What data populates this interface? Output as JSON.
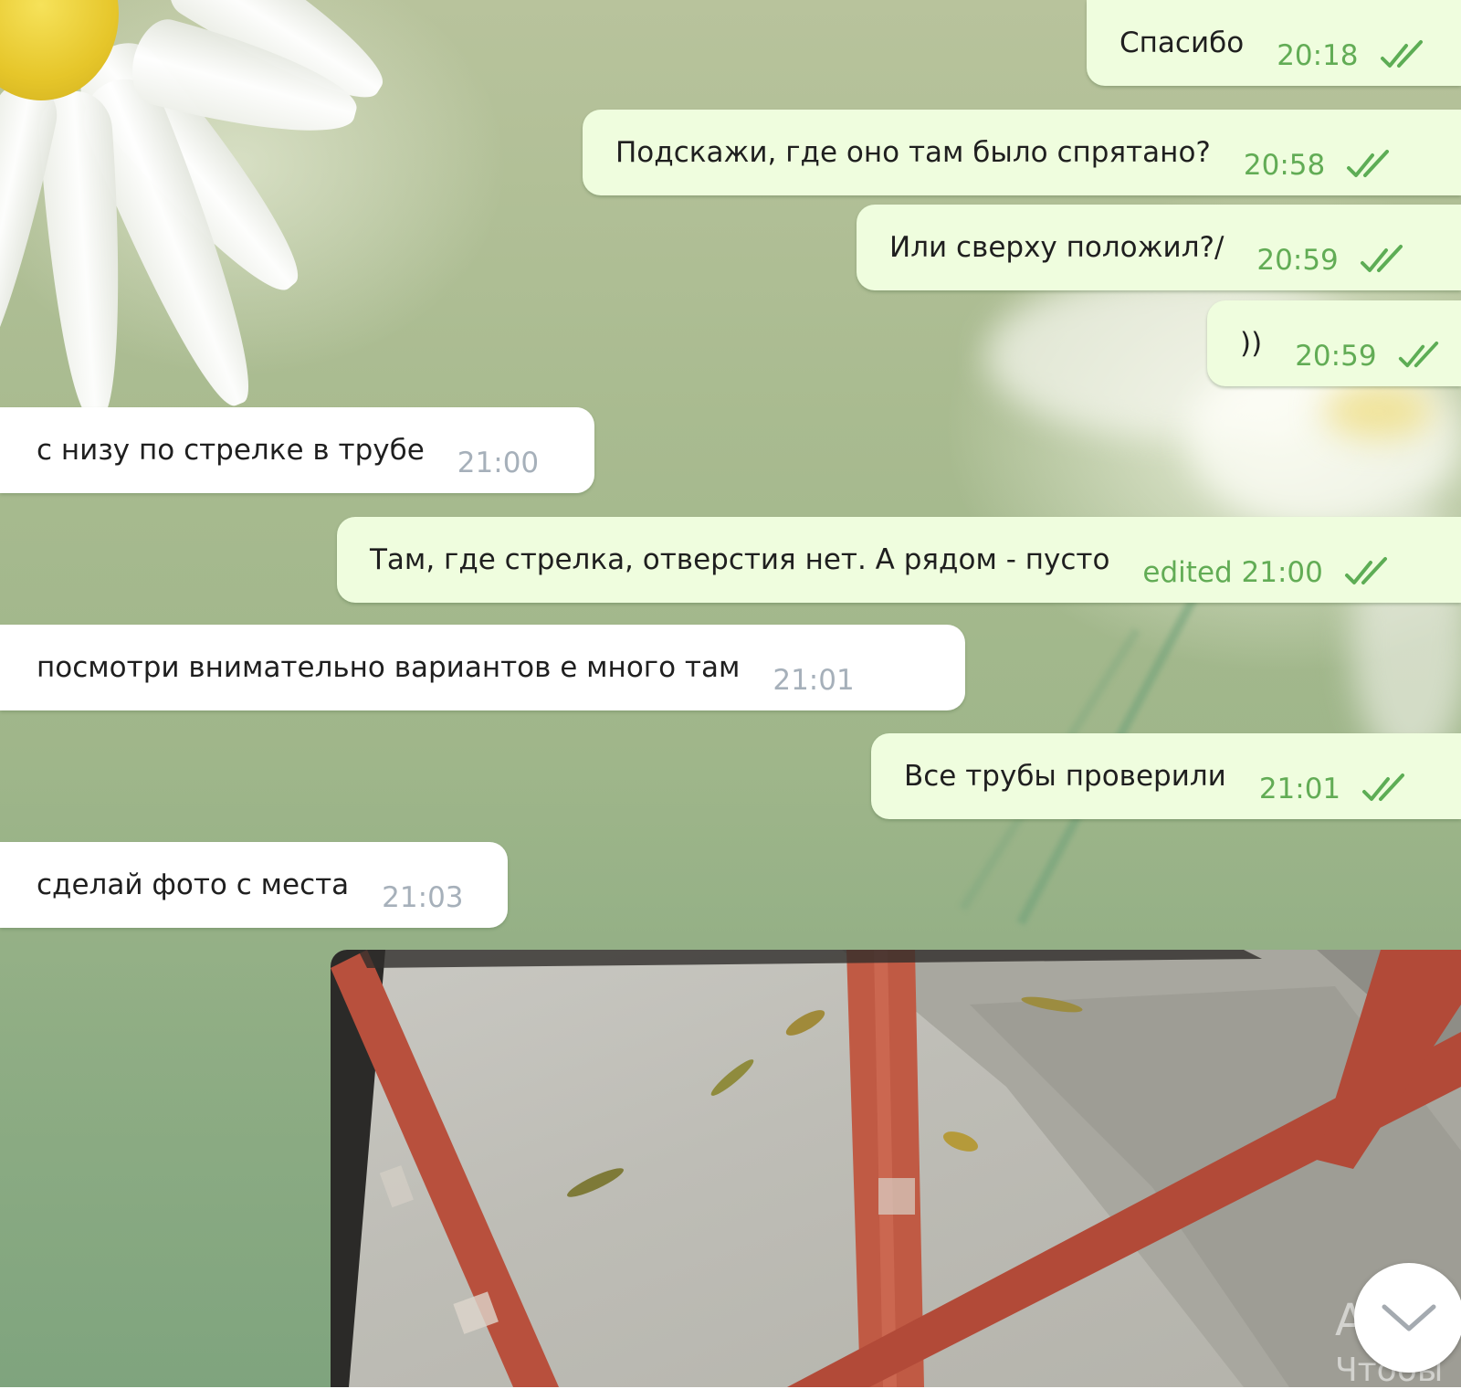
{
  "messages": [
    {
      "direction": "out",
      "text": "Спасибо",
      "time": "20:18",
      "status": "read"
    },
    {
      "direction": "out",
      "text": "Подскажи, где оно там было спрятано?",
      "time": "20:58",
      "status": "read"
    },
    {
      "direction": "out",
      "text": "Или сверху положил?/",
      "time": "20:59",
      "status": "read"
    },
    {
      "direction": "out",
      "text": "))",
      "time": "20:59",
      "status": "read"
    },
    {
      "direction": "in",
      "text": "с низу по стрелке в трубе",
      "time": "21:00"
    },
    {
      "direction": "out",
      "text": "Там, где стрелка, отверстия нет. А рядом - пусто",
      "time": "edited 21:00",
      "status": "read"
    },
    {
      "direction": "in",
      "text": "посмотри внимательно вариантов е много там",
      "time": "21:01"
    },
    {
      "direction": "out",
      "text": "Все трубы проверили",
      "time": "21:01",
      "status": "read"
    },
    {
      "direction": "in",
      "text": "сделай фото с места",
      "time": "21:03"
    }
  ],
  "photo": {
    "icon": "photo-attachment"
  },
  "watermark": {
    "line1": "Актив",
    "line2": "Чтобы"
  },
  "colors": {
    "outgoing_bubble": "#effdde",
    "incoming_bubble": "#ffffff",
    "read_check": "#5dad55",
    "out_time": "#62ac55",
    "in_time": "#a6b0ba"
  },
  "icons": {
    "read_status": "double-check-icon",
    "scroll": "chevron-down-icon"
  }
}
